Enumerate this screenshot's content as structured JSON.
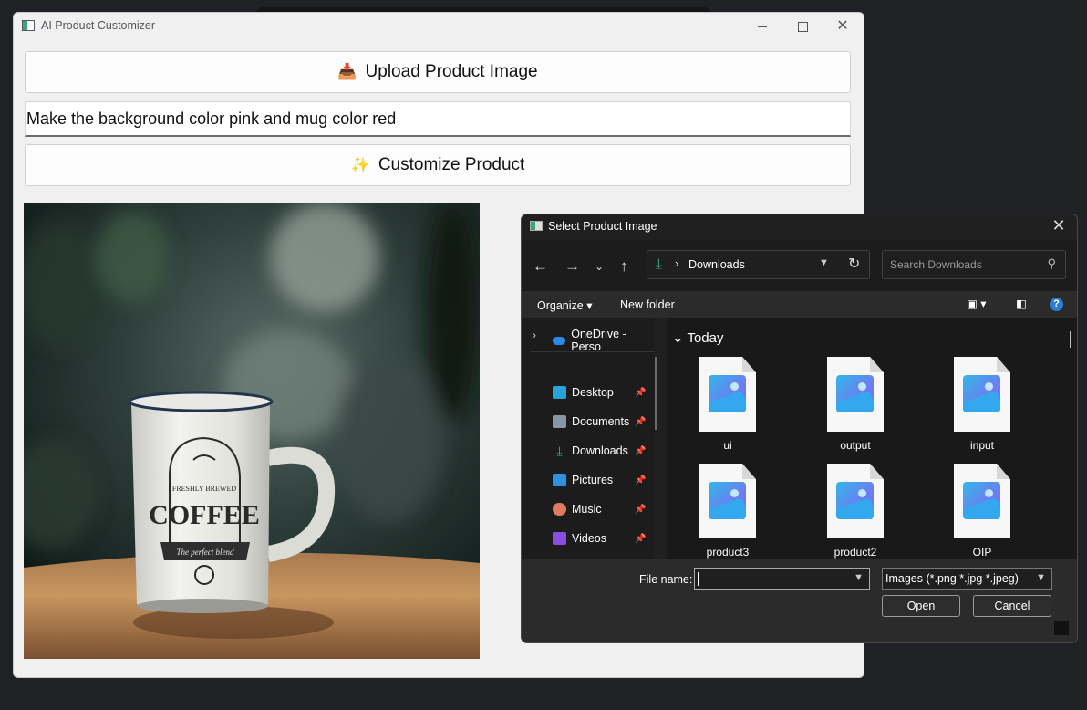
{
  "app": {
    "title": "AI Product Customizer",
    "upload_emoji": "📥",
    "upload_label": "Upload Product Image",
    "prompt_value": "Make the background color pink and mug color red",
    "customize_emoji": "✨",
    "customize_label": "Customize Product",
    "mug_text": {
      "top": "FRESHLY BREWED",
      "main": "COFFEE",
      "banner": "The perfect blend"
    }
  },
  "dialog": {
    "title": "Select Product Image",
    "address": "Downloads",
    "search_placeholder": "Search Downloads",
    "toolbar": {
      "organize": "Organize",
      "new_folder": "New folder"
    },
    "nav": {
      "onedrive": "OneDrive - Perso",
      "items": [
        {
          "label": "Desktop",
          "icon": "desktop-icon",
          "color": "#2aa3d8"
        },
        {
          "label": "Documents",
          "icon": "documents-icon",
          "color": "#8a95a5"
        },
        {
          "label": "Downloads",
          "icon": "download-icon",
          "color": "#3fbf8f"
        },
        {
          "label": "Pictures",
          "icon": "pictures-icon",
          "color": "#2f8fe0"
        },
        {
          "label": "Music",
          "icon": "music-icon",
          "color": "#e07a5f"
        },
        {
          "label": "Videos",
          "icon": "videos-icon",
          "color": "#8a4fe0"
        }
      ]
    },
    "section": "Today",
    "files": [
      "ui",
      "output",
      "input",
      "product3",
      "product2",
      "OIP"
    ],
    "file_name_label": "File name:",
    "file_name_value": "",
    "filter": "Images (*.png *.jpg *.jpeg)",
    "open_label": "Open",
    "cancel_label": "Cancel"
  }
}
